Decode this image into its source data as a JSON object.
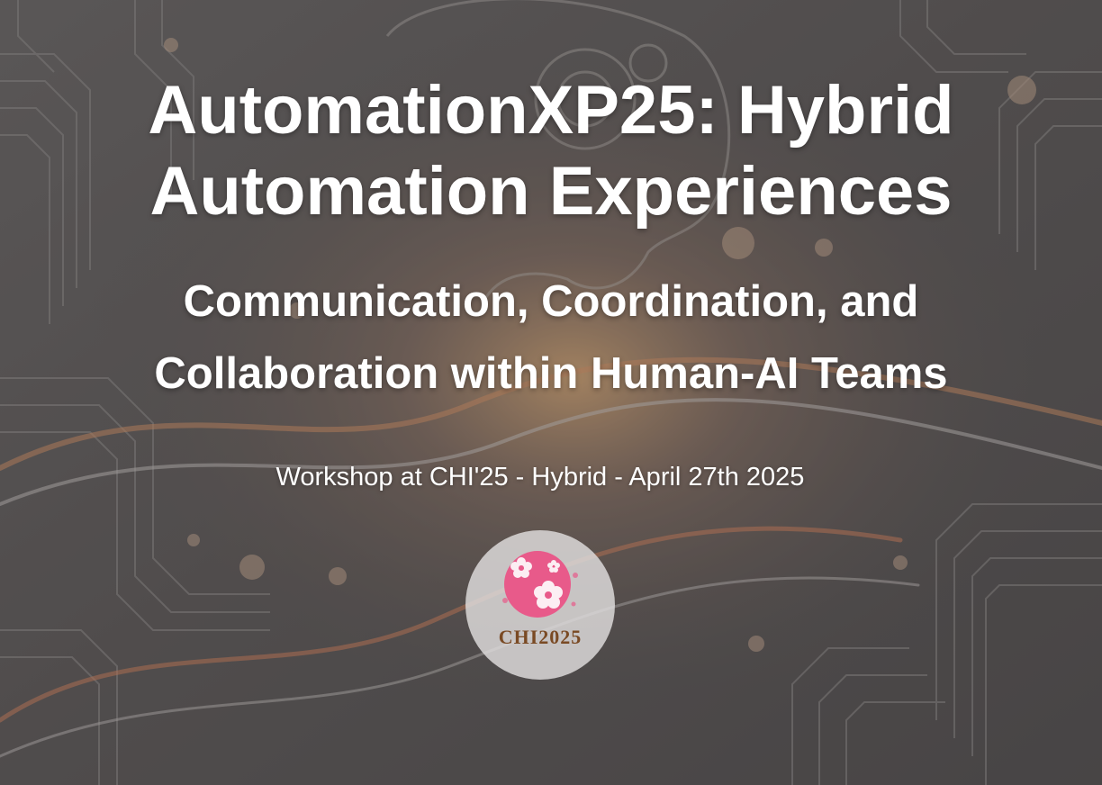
{
  "hero": {
    "title_line1": "AutomationXP25: Hybrid",
    "title_line2": "Automation Experiences",
    "subtitle_line1": "Communication, Coordination, and",
    "subtitle_line2": "Collaboration within Human-AI Teams",
    "tagline": "Workshop at CHI'25 - Hybrid - April 27th 2025"
  },
  "logo": {
    "text": "CHI2025",
    "icon": "cherry-blossom-icon",
    "accent_color": "#e85a8a",
    "text_color": "#7a4a24"
  },
  "background": {
    "icon": "circuit-board-head-illustration"
  }
}
